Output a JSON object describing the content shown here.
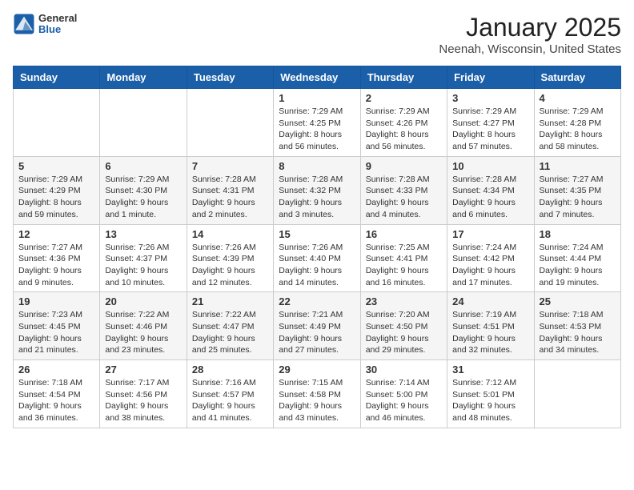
{
  "header": {
    "logo_general": "General",
    "logo_blue": "Blue",
    "month": "January 2025",
    "location": "Neenah, Wisconsin, United States"
  },
  "days_of_week": [
    "Sunday",
    "Monday",
    "Tuesday",
    "Wednesday",
    "Thursday",
    "Friday",
    "Saturday"
  ],
  "weeks": [
    [
      {
        "day": "",
        "info": ""
      },
      {
        "day": "",
        "info": ""
      },
      {
        "day": "",
        "info": ""
      },
      {
        "day": "1",
        "info": "Sunrise: 7:29 AM\nSunset: 4:25 PM\nDaylight: 8 hours\nand 56 minutes."
      },
      {
        "day": "2",
        "info": "Sunrise: 7:29 AM\nSunset: 4:26 PM\nDaylight: 8 hours\nand 56 minutes."
      },
      {
        "day": "3",
        "info": "Sunrise: 7:29 AM\nSunset: 4:27 PM\nDaylight: 8 hours\nand 57 minutes."
      },
      {
        "day": "4",
        "info": "Sunrise: 7:29 AM\nSunset: 4:28 PM\nDaylight: 8 hours\nand 58 minutes."
      }
    ],
    [
      {
        "day": "5",
        "info": "Sunrise: 7:29 AM\nSunset: 4:29 PM\nDaylight: 8 hours\nand 59 minutes."
      },
      {
        "day": "6",
        "info": "Sunrise: 7:29 AM\nSunset: 4:30 PM\nDaylight: 9 hours\nand 1 minute."
      },
      {
        "day": "7",
        "info": "Sunrise: 7:28 AM\nSunset: 4:31 PM\nDaylight: 9 hours\nand 2 minutes."
      },
      {
        "day": "8",
        "info": "Sunrise: 7:28 AM\nSunset: 4:32 PM\nDaylight: 9 hours\nand 3 minutes."
      },
      {
        "day": "9",
        "info": "Sunrise: 7:28 AM\nSunset: 4:33 PM\nDaylight: 9 hours\nand 4 minutes."
      },
      {
        "day": "10",
        "info": "Sunrise: 7:28 AM\nSunset: 4:34 PM\nDaylight: 9 hours\nand 6 minutes."
      },
      {
        "day": "11",
        "info": "Sunrise: 7:27 AM\nSunset: 4:35 PM\nDaylight: 9 hours\nand 7 minutes."
      }
    ],
    [
      {
        "day": "12",
        "info": "Sunrise: 7:27 AM\nSunset: 4:36 PM\nDaylight: 9 hours\nand 9 minutes."
      },
      {
        "day": "13",
        "info": "Sunrise: 7:26 AM\nSunset: 4:37 PM\nDaylight: 9 hours\nand 10 minutes."
      },
      {
        "day": "14",
        "info": "Sunrise: 7:26 AM\nSunset: 4:39 PM\nDaylight: 9 hours\nand 12 minutes."
      },
      {
        "day": "15",
        "info": "Sunrise: 7:26 AM\nSunset: 4:40 PM\nDaylight: 9 hours\nand 14 minutes."
      },
      {
        "day": "16",
        "info": "Sunrise: 7:25 AM\nSunset: 4:41 PM\nDaylight: 9 hours\nand 16 minutes."
      },
      {
        "day": "17",
        "info": "Sunrise: 7:24 AM\nSunset: 4:42 PM\nDaylight: 9 hours\nand 17 minutes."
      },
      {
        "day": "18",
        "info": "Sunrise: 7:24 AM\nSunset: 4:44 PM\nDaylight: 9 hours\nand 19 minutes."
      }
    ],
    [
      {
        "day": "19",
        "info": "Sunrise: 7:23 AM\nSunset: 4:45 PM\nDaylight: 9 hours\nand 21 minutes."
      },
      {
        "day": "20",
        "info": "Sunrise: 7:22 AM\nSunset: 4:46 PM\nDaylight: 9 hours\nand 23 minutes."
      },
      {
        "day": "21",
        "info": "Sunrise: 7:22 AM\nSunset: 4:47 PM\nDaylight: 9 hours\nand 25 minutes."
      },
      {
        "day": "22",
        "info": "Sunrise: 7:21 AM\nSunset: 4:49 PM\nDaylight: 9 hours\nand 27 minutes."
      },
      {
        "day": "23",
        "info": "Sunrise: 7:20 AM\nSunset: 4:50 PM\nDaylight: 9 hours\nand 29 minutes."
      },
      {
        "day": "24",
        "info": "Sunrise: 7:19 AM\nSunset: 4:51 PM\nDaylight: 9 hours\nand 32 minutes."
      },
      {
        "day": "25",
        "info": "Sunrise: 7:18 AM\nSunset: 4:53 PM\nDaylight: 9 hours\nand 34 minutes."
      }
    ],
    [
      {
        "day": "26",
        "info": "Sunrise: 7:18 AM\nSunset: 4:54 PM\nDaylight: 9 hours\nand 36 minutes."
      },
      {
        "day": "27",
        "info": "Sunrise: 7:17 AM\nSunset: 4:56 PM\nDaylight: 9 hours\nand 38 minutes."
      },
      {
        "day": "28",
        "info": "Sunrise: 7:16 AM\nSunset: 4:57 PM\nDaylight: 9 hours\nand 41 minutes."
      },
      {
        "day": "29",
        "info": "Sunrise: 7:15 AM\nSunset: 4:58 PM\nDaylight: 9 hours\nand 43 minutes."
      },
      {
        "day": "30",
        "info": "Sunrise: 7:14 AM\nSunset: 5:00 PM\nDaylight: 9 hours\nand 46 minutes."
      },
      {
        "day": "31",
        "info": "Sunrise: 7:12 AM\nSunset: 5:01 PM\nDaylight: 9 hours\nand 48 minutes."
      },
      {
        "day": "",
        "info": ""
      }
    ]
  ]
}
